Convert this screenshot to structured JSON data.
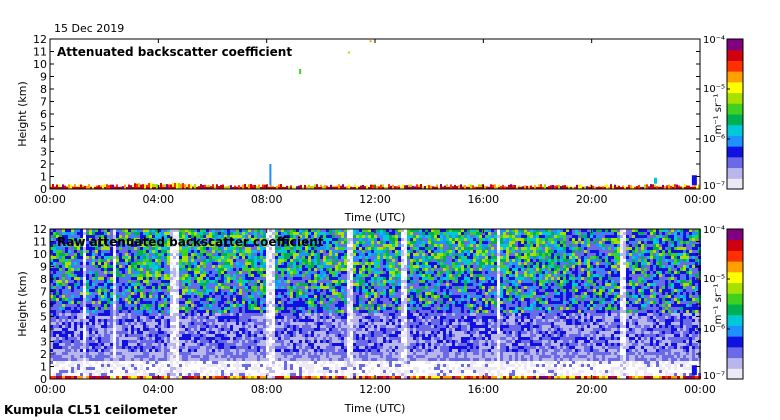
{
  "date": "15 Dec 2019",
  "footer": "Kumpula CL51 ceilometer",
  "colorbar": {
    "unit": "m⁻¹ sr⁻¹",
    "ticks": [
      "10⁻⁴",
      "10⁻⁵",
      "10⁻⁶",
      "10⁻⁷"
    ],
    "colors": [
      "#ece9f5",
      "#b8b6ea",
      "#6a6ae6",
      "#1010e0",
      "#1e90ff",
      "#00c8d8",
      "#00b050",
      "#40d020",
      "#a8e000",
      "#ffff00",
      "#ffa000",
      "#ff3000",
      "#d00010",
      "#800080"
    ]
  },
  "chart_data": [
    {
      "type": "heatmap",
      "title": "Attenuated backscatter coefficient",
      "xlabel": "Time (UTC)",
      "ylabel": "Height (km)",
      "xticks": [
        "00:00",
        "04:00",
        "08:00",
        "12:00",
        "16:00",
        "20:00",
        "00:00"
      ],
      "yticks": [
        0,
        1,
        2,
        3,
        4,
        5,
        6,
        7,
        8,
        9,
        10,
        11,
        12
      ],
      "xlim_hours": [
        0,
        24
      ],
      "ylim_km": [
        0,
        12
      ],
      "scale": "log",
      "colorbar_range": [
        "1e-7",
        "1e-4"
      ],
      "description_of_values": "signal confined to lowest ~0.3 km throughout the day; brief feature to ~2 km near 08:00; isolated specks near 9.5 km at ~09:00 and ~11-12 km near 11:00"
    },
    {
      "type": "heatmap",
      "title": "Raw attenuated backscatter coefficient",
      "xlabel": "Time (UTC)",
      "ylabel": "Height (km)",
      "xticks": [
        "00:00",
        "04:00",
        "08:00",
        "12:00",
        "16:00",
        "20:00",
        "00:00"
      ],
      "yticks": [
        0,
        1,
        2,
        3,
        4,
        5,
        6,
        7,
        8,
        9,
        10,
        11,
        12
      ],
      "xlim_hours": [
        0,
        24
      ],
      "ylim_km": [
        0,
        12
      ],
      "scale": "log",
      "colorbar_range": [
        "1e-7",
        "1e-4"
      ],
      "description_of_values": "noisy field; low layer up to ~2 km; blue noise 2-6 km; green (1e-6 to 1e-5) noise above ~6 km, strongest 03:00-19:00; vertical white gaps near 04:30, 08:00, 11:00, 13:00, 16:30, 21:00"
    }
  ]
}
